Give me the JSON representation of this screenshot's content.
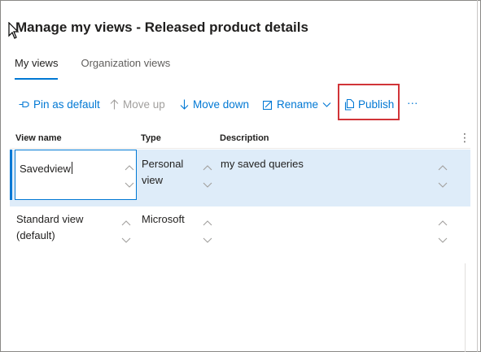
{
  "title": "Manage my views - Released product details",
  "tabs": [
    {
      "label": "My views"
    },
    {
      "label": "Organization views"
    }
  ],
  "toolbar": {
    "pin_label": "Pin as default",
    "move_up_label": "Move up",
    "move_down_label": "Move down",
    "rename_label": "Rename",
    "publish_label": "Publish",
    "more_label": "···"
  },
  "grid": {
    "headers": [
      "View name",
      "Type",
      "Description"
    ],
    "rows": [
      {
        "name": "Savedview",
        "type": "Personal view",
        "description": "my saved queries"
      },
      {
        "name": "Standard view (default)",
        "type": "Microsoft",
        "description": ""
      }
    ]
  },
  "colors": {
    "accent": "#0078d4",
    "selected_row": "#deecf9",
    "highlight_box": "#d13438"
  }
}
